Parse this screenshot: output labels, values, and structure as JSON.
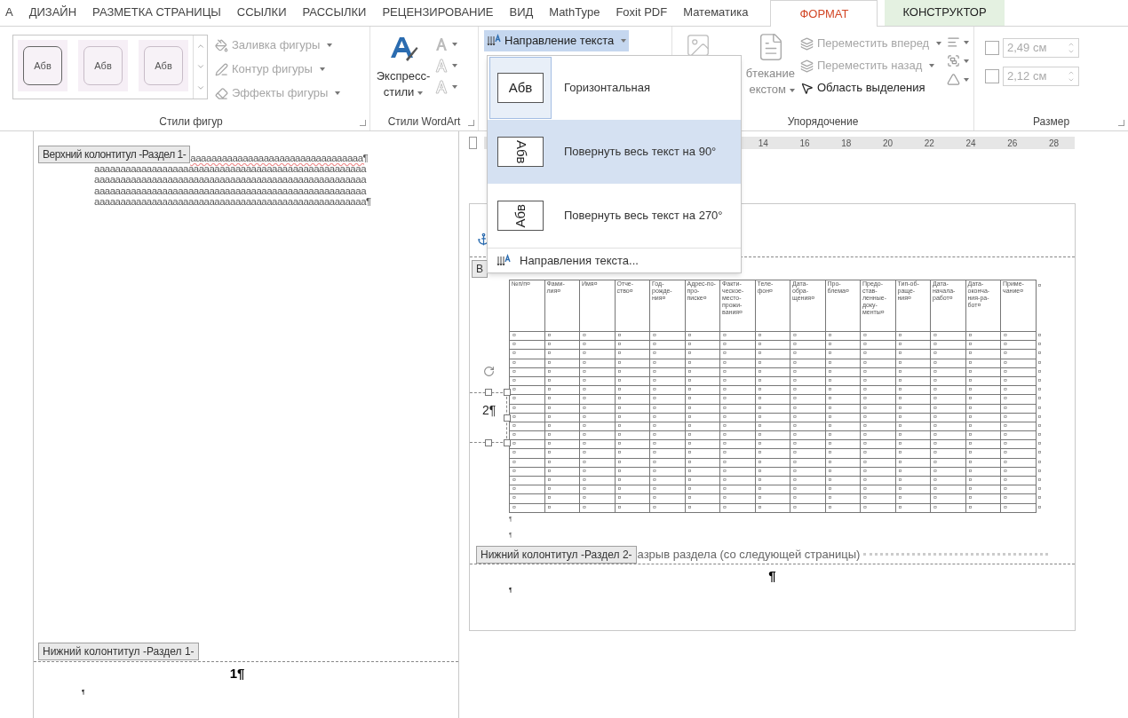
{
  "tabs": [
    {
      "label": "А",
      "selected": false,
      "kind": "normal"
    },
    {
      "label": "ДИЗАЙН",
      "selected": false,
      "kind": "normal"
    },
    {
      "label": "РАЗМЕТКА СТРАНИЦЫ",
      "selected": false,
      "kind": "normal"
    },
    {
      "label": "ССЫЛКИ",
      "selected": false,
      "kind": "normal"
    },
    {
      "label": "РАССЫЛКИ",
      "selected": false,
      "kind": "normal"
    },
    {
      "label": "РЕЦЕНЗИРОВАНИЕ",
      "selected": false,
      "kind": "normal"
    },
    {
      "label": "ВИД",
      "selected": false,
      "kind": "normal"
    },
    {
      "label": "MathType",
      "selected": false,
      "kind": "normal"
    },
    {
      "label": "Foxit PDF",
      "selected": false,
      "kind": "normal"
    },
    {
      "label": "Математика",
      "selected": false,
      "kind": "normal"
    },
    {
      "label": "ФОРМАТ",
      "selected": true,
      "kind": "normal"
    },
    {
      "label": "КОНСТРУКТОР",
      "selected": false,
      "kind": "contextual"
    }
  ],
  "ribbon": {
    "shape_styles": {
      "title": "Стили фигур",
      "gallery": [
        {
          "label": "Абв",
          "selected": true
        },
        {
          "label": "Абв",
          "selected": false
        },
        {
          "label": "Абв",
          "selected": false
        }
      ],
      "commands": [
        {
          "label": "Заливка фигуры",
          "disabled": true,
          "kind": "fill"
        },
        {
          "label": "Контур фигуры",
          "disabled": true,
          "kind": "outline"
        },
        {
          "label": "Эффекты фигуры",
          "disabled": true,
          "kind": "effects"
        }
      ]
    },
    "wordart": {
      "title": "Стили WordArt",
      "quick_styles": [
        "Экспресс-",
        "стили"
      ]
    },
    "text": {
      "direction_button": "Направление текста",
      "pressed": true
    },
    "arrange": {
      "title": "Упорядочение",
      "wrap": [
        "бтекание",
        "екстом"
      ],
      "commands": [
        {
          "label": "Переместить вперед",
          "disabled": true
        },
        {
          "label": "Переместить назад",
          "disabled": true
        },
        {
          "label": "Область выделения",
          "disabled": false
        }
      ]
    },
    "size": {
      "title": "Размер",
      "height": "2,49 см",
      "width": "2,12 см"
    }
  },
  "text_direction_menu": {
    "items": [
      {
        "label": "Горизонтальная",
        "sample": "Абв",
        "kind": "horizontal",
        "selected": true,
        "hovered": false
      },
      {
        "label": "Повернуть весь текст на 90°",
        "sample": "Абв",
        "kind": "rotate90",
        "selected": false,
        "hovered": true
      },
      {
        "label": "Повернуть весь текст на 270°",
        "sample": "Абв",
        "kind": "rotate270",
        "selected": false,
        "hovered": false
      }
    ],
    "footer": "Направления текста..."
  },
  "ruler": [
    "14",
    "16",
    "18",
    "20",
    "22",
    "24",
    "26",
    "28"
  ],
  "left_page": {
    "header_label": "Верхний колонтитул -Раздел 1-",
    "lines": [
      "aaaaaaaaaaaaaaaaaaaaaaaaaaaaaaaaa¶",
      "aaaaaaaaaaaaaaaaaaaaaaaaaaaaaaaaaaaaaaaaaaaaaaaaaaaa",
      "aaaaaaaaaaaaaaaaaaaaaaaaaaaaaaaaaaaaaaaaaaaaaaaaaaaa",
      "aaaaaaaaaaaaaaaaaaaaaaaaaaaaaaaaaaaaaaaaaaaaaaaaaaaa",
      "aaaaaaaaaaaaaaaaaaaaaaaaaaaaaaaaaaaaaaaaaaaaaaaaaaaa¶"
    ],
    "footer_label": "Нижний колонтитул -Раздел 1-",
    "page_number": "1¶",
    "footer_mark": "¶"
  },
  "right_page": {
    "header_label": "В",
    "page_number": "2¶",
    "table": {
      "columns": [
        "№п/п¤",
        "Фами-лия¤",
        "Имя¤",
        "Отче-ство¤",
        "Год-рожде-ния¤",
        "Адрес-по-про-писке¤",
        "Факти-ческое-место-прожи-вания¤",
        "Теле-фон¤",
        "Дата-обра-щения¤",
        "Про-блема¤",
        "Предо-став-ленные-доку-менты¤",
        "Тип-об-раще-ния¤",
        "Дата-начала-работ¤",
        "Дата-оконча-ния-ра-бот¤",
        "Приме-чание¤"
      ],
      "header_end": "¤",
      "rows": [
        [
          "¤",
          "¤",
          "¤",
          "¤",
          "¤",
          "¤",
          "¤",
          "¤",
          "¤",
          "¤",
          "¤",
          "¤",
          "¤",
          "¤",
          "¤",
          "¤"
        ],
        [
          "¤",
          "¤",
          "¤",
          "¤",
          "¤",
          "¤",
          "¤",
          "¤",
          "¤",
          "¤",
          "¤",
          "¤",
          "¤",
          "¤",
          "¤",
          "¤"
        ],
        [
          "¤",
          "¤",
          "¤",
          "¤",
          "¤",
          "¤",
          "¤",
          "¤",
          "¤",
          "¤",
          "¤",
          "¤",
          "¤",
          "¤",
          "¤",
          "¤"
        ],
        [
          "¤",
          "¤",
          "¤",
          "¤",
          "¤",
          "¤",
          "¤",
          "¤",
          "¤",
          "¤",
          "¤",
          "¤",
          "¤",
          "¤",
          "¤",
          "¤"
        ],
        [
          "¤",
          "¤",
          "¤",
          "¤",
          "¤",
          "¤",
          "¤",
          "¤",
          "¤",
          "¤",
          "¤",
          "¤",
          "¤",
          "¤",
          "¤",
          "¤"
        ],
        [
          "¤",
          "¤",
          "¤",
          "¤",
          "¤",
          "¤",
          "¤",
          "¤",
          "¤",
          "¤",
          "¤",
          "¤",
          "¤",
          "¤",
          "¤",
          "¤"
        ],
        [
          "¤",
          "¤",
          "¤",
          "¤",
          "¤",
          "¤",
          "¤",
          "¤",
          "¤",
          "¤",
          "¤",
          "¤",
          "¤",
          "¤",
          "¤",
          "¤"
        ],
        [
          "¤",
          "¤",
          "¤",
          "¤",
          "¤",
          "¤",
          "¤",
          "¤",
          "¤",
          "¤",
          "¤",
          "¤",
          "¤",
          "¤",
          "¤",
          "¤"
        ],
        [
          "¤",
          "¤",
          "¤",
          "¤",
          "¤",
          "¤",
          "¤",
          "¤",
          "¤",
          "¤",
          "¤",
          "¤",
          "¤",
          "¤",
          "¤",
          "¤"
        ],
        [
          "¤",
          "¤",
          "¤",
          "¤",
          "¤",
          "¤",
          "¤",
          "¤",
          "¤",
          "¤",
          "¤",
          "¤",
          "¤",
          "¤",
          "¤",
          "¤"
        ],
        [
          "¤",
          "¤",
          "¤",
          "¤",
          "¤",
          "¤",
          "¤",
          "¤",
          "¤",
          "¤",
          "¤",
          "¤",
          "¤",
          "¤",
          "¤",
          "¤"
        ],
        [
          "¤",
          "¤",
          "¤",
          "¤",
          "¤",
          "¤",
          "¤",
          "¤",
          "¤",
          "¤",
          "¤",
          "¤",
          "¤",
          "¤",
          "¤",
          "¤"
        ],
        [
          "¤",
          "¤",
          "¤",
          "¤",
          "¤",
          "¤",
          "¤",
          "¤",
          "¤",
          "¤",
          "¤",
          "¤",
          "¤",
          "¤",
          "¤",
          "¤"
        ],
        [
          "¤",
          "¤",
          "¤",
          "¤",
          "¤",
          "¤",
          "¤",
          "¤",
          "¤",
          "¤",
          "¤",
          "¤",
          "¤",
          "¤",
          "¤",
          "¤"
        ],
        [
          "¤",
          "¤",
          "¤",
          "¤",
          "¤",
          "¤",
          "¤",
          "¤",
          "¤",
          "¤",
          "¤",
          "¤",
          "¤",
          "¤",
          "¤",
          "¤"
        ],
        [
          "¤",
          "¤",
          "¤",
          "¤",
          "¤",
          "¤",
          "¤",
          "¤",
          "¤",
          "¤",
          "¤",
          "¤",
          "¤",
          "¤",
          "¤",
          "¤"
        ],
        [
          "¤",
          "¤",
          "¤",
          "¤",
          "¤",
          "¤",
          "¤",
          "¤",
          "¤",
          "¤",
          "¤",
          "¤",
          "¤",
          "¤",
          "¤",
          "¤"
        ],
        [
          "¤",
          "¤",
          "¤",
          "¤",
          "¤",
          "¤",
          "¤",
          "¤",
          "¤",
          "¤",
          "¤",
          "¤",
          "¤",
          "¤",
          "¤",
          "¤"
        ],
        [
          "¤",
          "¤",
          "¤",
          "¤",
          "¤",
          "¤",
          "¤",
          "¤",
          "¤",
          "¤",
          "¤",
          "¤",
          "¤",
          "¤",
          "¤",
          "¤"
        ],
        [
          "¤",
          "¤",
          "¤",
          "¤",
          "¤",
          "¤",
          "¤",
          "¤",
          "¤",
          "¤",
          "¤",
          "¤",
          "¤",
          "¤",
          "¤",
          "¤"
        ]
      ]
    },
    "after_table": [
      "¶",
      "¶"
    ],
    "footer_label": "Нижний колонтитул -Раздел 2-",
    "section_break": "азрыв раздела (со следующей страницы)",
    "footer_center": "¶",
    "footer_mark": "¶"
  }
}
